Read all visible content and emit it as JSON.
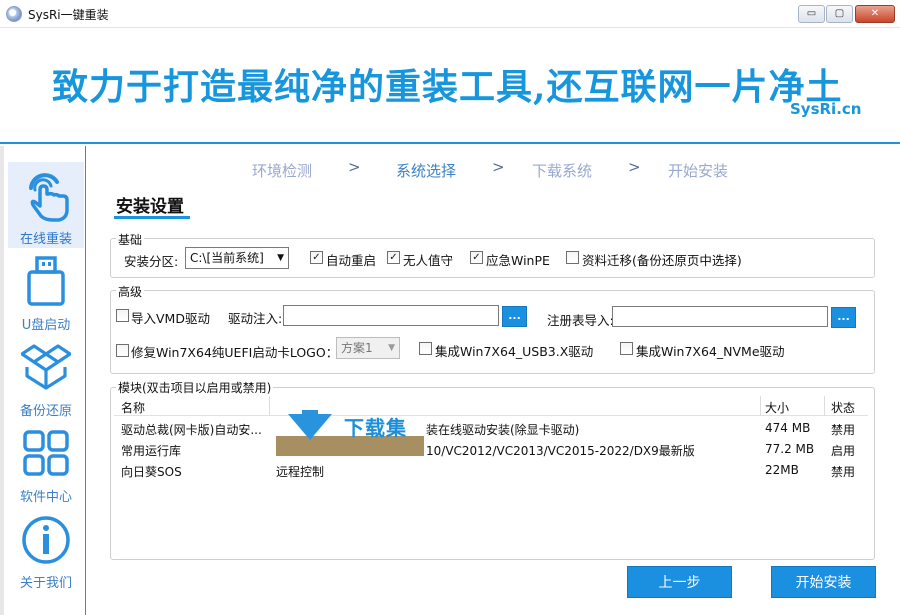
{
  "window": {
    "title": "SysRi一键重装",
    "minimize_glyph": "▭",
    "maximize_glyph": "▢",
    "close_glyph": "✕"
  },
  "banner": {
    "slogan": "致力于打造最纯净的重装工具,还互联网一片净土",
    "brand": "SysRi.cn"
  },
  "sidebar": {
    "items": [
      {
        "label": "在线重装",
        "icon": "tap-hand-icon",
        "active": true
      },
      {
        "label": "U盘启动",
        "icon": "usb-drive-icon",
        "active": false
      },
      {
        "label": "备份还原",
        "icon": "dropbox-icon",
        "active": false
      },
      {
        "label": "软件中心",
        "icon": "app-grid-icon",
        "active": false
      },
      {
        "label": "关于我们",
        "icon": "info-icon",
        "active": false
      }
    ]
  },
  "steps": {
    "items": [
      "环境检测",
      "系统选择",
      "下载系统",
      "开始安装"
    ],
    "current_index": 1,
    "separator": ">"
  },
  "section_title": "安装设置",
  "basic": {
    "label": "基础",
    "partition_label": "安装分区:",
    "partition_value": "C:\\[当前系统]",
    "auto_restart": {
      "label": "自动重启",
      "checked": true
    },
    "unattended": {
      "label": "无人值守",
      "checked": true
    },
    "emergency_pe": {
      "label": "应急WinPE",
      "checked": true
    },
    "data_migration": {
      "label": "资料迁移(备份还原页中选择)",
      "checked": false
    }
  },
  "advanced": {
    "label": "高级",
    "import_vmd": {
      "label": "导入VMD驱动",
      "checked": false
    },
    "driver_inject_label": "驱动注入:",
    "driver_inject_value": "",
    "driver_browse": "...",
    "registry_import_label": "注册表导入:",
    "registry_import_value": "",
    "registry_browse": "...",
    "fix_uefi": {
      "label": "修复Win7X64纯UEFI启动卡LOGO：",
      "checked": false
    },
    "scheme_value": "方案1",
    "usb3": {
      "label": "集成Win7X64_USB3.X驱动",
      "checked": false
    },
    "nvme": {
      "label": "集成Win7X64_NVMe驱动",
      "checked": false
    }
  },
  "modules": {
    "label": "模块(双击项目以启用或禁用)",
    "columns": {
      "name": "名称",
      "size": "大小",
      "status": "状态"
    },
    "rows": [
      {
        "name": "驱动总裁(网卡版)自动安...",
        "desc": "装在线驱动安装(除显卡驱动)",
        "size": "474 MB",
        "status": "禁用"
      },
      {
        "name": "常用运行库",
        "desc": "10/VC2012/VC2013/VC2015-2022/DX9最新版",
        "size": "77.2 MB",
        "status": "启用"
      },
      {
        "name": "向日葵SOS",
        "desc": "远程控制",
        "size": "22MB",
        "status": "禁用"
      }
    ]
  },
  "watermark": {
    "text": "下载集"
  },
  "buttons": {
    "prev": "上一步",
    "start": "开始安装"
  },
  "colors": {
    "accent": "#1b8fe0",
    "slogan": "#1796de",
    "step_inactive": "#98a8cf",
    "step_active": "#3e82c6"
  }
}
